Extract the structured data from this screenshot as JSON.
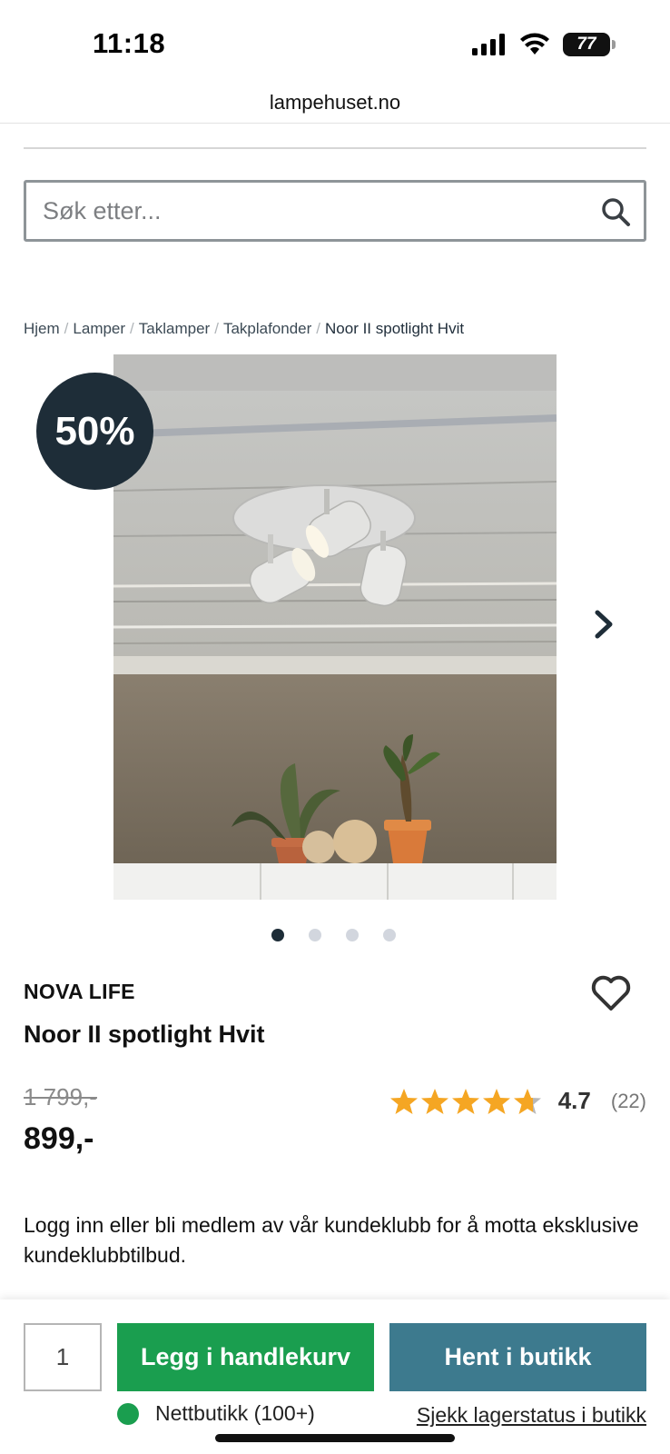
{
  "status_bar": {
    "time": "11:18",
    "battery": "77"
  },
  "browser": {
    "url": "lampehuset.no"
  },
  "search": {
    "placeholder": "Søk etter..."
  },
  "breadcrumb": [
    "Hjem",
    "Lamper",
    "Taklamper",
    "Takplafonder",
    "Noor II spotlight Hvit"
  ],
  "gallery": {
    "discount_badge": "50%",
    "image_count": 4,
    "active_index": 0
  },
  "product": {
    "brand": "NOVA LIFE",
    "title": "Noor II spotlight Hvit",
    "old_price": "1 799,-",
    "price": "899,-",
    "rating_value": "4.7",
    "rating_count": "(22)",
    "rating_stars": 4.7
  },
  "club_message": "Logg inn eller bli medlem av vår kundeklubb for å motta eksklusive kundeklubbtilbud.",
  "purchase": {
    "quantity": "1",
    "add_to_cart_label": "Legg i handlekurv",
    "pickup_label": "Hent i butikk",
    "stock_text": "Nettbutikk (100+)",
    "store_stock_link": "Sjekk lagerstatus i butikk"
  },
  "colors": {
    "accent_dark": "#1e2d38",
    "cart_green": "#1a9e4f",
    "store_teal": "#3d7a8e",
    "star": "#f5a623"
  }
}
